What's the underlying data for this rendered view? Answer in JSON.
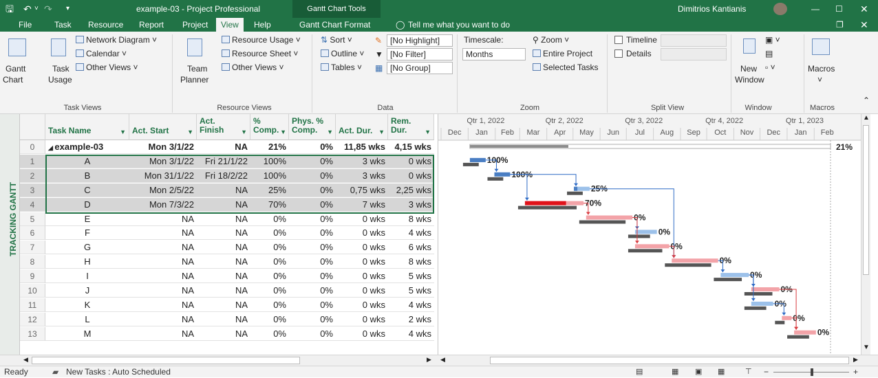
{
  "app": {
    "title": "example-03 - Project Professional",
    "context_tab": "Gantt Chart Tools",
    "user": "Dimitrios Kantianis"
  },
  "tabs": [
    "File",
    "Task",
    "Resource",
    "Report",
    "Project",
    "View",
    "Help",
    "Gantt Chart Format"
  ],
  "tell_me": "Tell me what you want to do",
  "ribbon": {
    "task_views": {
      "gantt": "Gantt",
      "gantt2": "Chart",
      "task_usage": "Task",
      "task_usage2": "Usage",
      "network": "Network Diagram",
      "calendar": "Calendar",
      "other": "Other Views",
      "label": "Task Views"
    },
    "resource_views": {
      "team": "Team",
      "team2": "Planner",
      "usage": "Resource Usage",
      "sheet": "Resource Sheet",
      "other": "Other Views",
      "label": "Resource Views"
    },
    "data": {
      "sort": "Sort",
      "outline": "Outline",
      "tables": "Tables",
      "highlight": "[No Highlight]",
      "filter": "[No Filter]",
      "group": "[No Group]",
      "label": "Data"
    },
    "zoom": {
      "timescale_label": "Timescale:",
      "timescale": "Months",
      "zoom": "Zoom",
      "entire": "Entire Project",
      "selected": "Selected Tasks",
      "label": "Zoom"
    },
    "split": {
      "timeline": "Timeline",
      "details": "Details",
      "label": "Split View"
    },
    "window": {
      "new": "New",
      "new2": "Window",
      "label": "Window"
    },
    "macros": {
      "macros": "Macros",
      "label": "Macros"
    }
  },
  "view_bar": "TRACKING GANTT",
  "columns": [
    "Task Name",
    "Act. Start",
    "Act. Finish",
    "% Comp.",
    "Phys. % Comp.",
    "Act. Dur.",
    "Rem. Dur."
  ],
  "rows": [
    {
      "id": "0",
      "name": "example-03",
      "start": "Mon 3/1/22",
      "finish": "NA",
      "comp": "21%",
      "phys": "0%",
      "adur": "11,85 wks",
      "rdur": "4,15 wks",
      "summary": true,
      "pct": 0.21
    },
    {
      "id": "1",
      "name": "A",
      "start": "Mon 3/1/22",
      "finish": "Fri 21/1/22",
      "comp": "100%",
      "phys": "0%",
      "adur": "3 wks",
      "rdur": "0 wks",
      "pct": 1
    },
    {
      "id": "2",
      "name": "B",
      "start": "Mon 31/1/22",
      "finish": "Fri 18/2/22",
      "comp": "100%",
      "phys": "0%",
      "adur": "3 wks",
      "rdur": "0 wks",
      "pct": 1
    },
    {
      "id": "3",
      "name": "C",
      "start": "Mon 2/5/22",
      "finish": "NA",
      "comp": "25%",
      "phys": "0%",
      "adur": "0,75 wks",
      "rdur": "2,25 wks",
      "pct": 0.25
    },
    {
      "id": "4",
      "name": "D",
      "start": "Mon 7/3/22",
      "finish": "NA",
      "comp": "70%",
      "phys": "0%",
      "adur": "7 wks",
      "rdur": "3 wks",
      "pct": 0.7
    },
    {
      "id": "5",
      "name": "E",
      "start": "NA",
      "finish": "NA",
      "comp": "0%",
      "phys": "0%",
      "adur": "0 wks",
      "rdur": "8 wks",
      "pct": 0
    },
    {
      "id": "6",
      "name": "F",
      "start": "NA",
      "finish": "NA",
      "comp": "0%",
      "phys": "0%",
      "adur": "0 wks",
      "rdur": "4 wks",
      "pct": 0
    },
    {
      "id": "7",
      "name": "G",
      "start": "NA",
      "finish": "NA",
      "comp": "0%",
      "phys": "0%",
      "adur": "0 wks",
      "rdur": "6 wks",
      "pct": 0
    },
    {
      "id": "8",
      "name": "H",
      "start": "NA",
      "finish": "NA",
      "comp": "0%",
      "phys": "0%",
      "adur": "0 wks",
      "rdur": "8 wks",
      "pct": 0
    },
    {
      "id": "9",
      "name": "I",
      "start": "NA",
      "finish": "NA",
      "comp": "0%",
      "phys": "0%",
      "adur": "0 wks",
      "rdur": "5 wks",
      "pct": 0
    },
    {
      "id": "10",
      "name": "J",
      "start": "NA",
      "finish": "NA",
      "comp": "0%",
      "phys": "0%",
      "adur": "0 wks",
      "rdur": "5 wks",
      "pct": 0
    },
    {
      "id": "11",
      "name": "K",
      "start": "NA",
      "finish": "NA",
      "comp": "0%",
      "phys": "0%",
      "adur": "0 wks",
      "rdur": "4 wks",
      "pct": 0
    },
    {
      "id": "12",
      "name": "L",
      "start": "NA",
      "finish": "NA",
      "comp": "0%",
      "phys": "0%",
      "adur": "0 wks",
      "rdur": "2 wks",
      "pct": 0
    },
    {
      "id": "13",
      "name": "M",
      "start": "NA",
      "finish": "NA",
      "comp": "0%",
      "phys": "0%",
      "adur": "0 wks",
      "rdur": "4 wks",
      "pct": 0
    }
  ],
  "timescale": {
    "quarters": [
      "Qtr 1, 2022",
      "Qtr 2, 2022",
      "Qtr 3, 2022",
      "Qtr 4, 2022",
      "Qtr 1, 2023"
    ],
    "months": [
      "Dec",
      "Jan",
      "Feb",
      "Mar",
      "Apr",
      "May",
      "Jun",
      "Jul",
      "Aug",
      "Sep",
      "Oct",
      "Nov",
      "Dec",
      "Jan",
      "Feb"
    ]
  },
  "gantt": {
    "summary": {
      "start": "2022-01-03",
      "finish": "2022-06-08",
      "label": "21%"
    },
    "tasks": [
      {
        "row": 1,
        "start": "2022-01-03",
        "finish": "2022-01-21",
        "label": "100%",
        "actual_finish": "2022-01-21"
      },
      {
        "row": 2,
        "start": "2022-01-31",
        "finish": "2022-02-18",
        "label": "100%",
        "actual_finish": "2022-02-18"
      },
      {
        "row": 3,
        "start": "2022-05-02",
        "finish": "2022-05-20",
        "label": "25%",
        "actual_finish": "2022-05-06"
      },
      {
        "row": 4,
        "start": "2022-03-07",
        "finish": "2022-05-13",
        "label": "70%",
        "actual_finish": "2022-04-23"
      },
      {
        "row": 5,
        "start": "2022-05-16",
        "finish": "2022-07-08",
        "label": "0%"
      },
      {
        "row": 6,
        "start": "2022-07-11",
        "finish": "2022-08-05",
        "label": "0%"
      },
      {
        "row": 7,
        "start": "2022-07-11",
        "finish": "2022-08-19",
        "label": "0%"
      },
      {
        "row": 8,
        "start": "2022-08-22",
        "finish": "2022-10-14",
        "label": "0%"
      },
      {
        "row": 9,
        "start": "2022-10-17",
        "finish": "2022-11-18",
        "label": "0%"
      },
      {
        "row": 10,
        "start": "2022-11-21",
        "finish": "2022-12-23",
        "label": "0%"
      },
      {
        "row": 11,
        "start": "2022-11-21",
        "finish": "2022-12-16",
        "label": "0%"
      },
      {
        "row": 12,
        "start": "2022-12-26",
        "finish": "2023-01-06",
        "label": "0%"
      },
      {
        "row": 13,
        "start": "2023-01-09",
        "finish": "2023-02-03",
        "label": "0%"
      }
    ]
  },
  "status": {
    "ready": "Ready",
    "new_tasks": "New Tasks : Auto Scheduled"
  },
  "colors": {
    "brand": "#217346",
    "critical": "#e0121a",
    "critical_light": "#f3a3a8",
    "noncritical": "#4a7ec3",
    "noncritical_light": "#9cc1ea",
    "baseline": "#555555",
    "summary": "#8c8c8c"
  }
}
